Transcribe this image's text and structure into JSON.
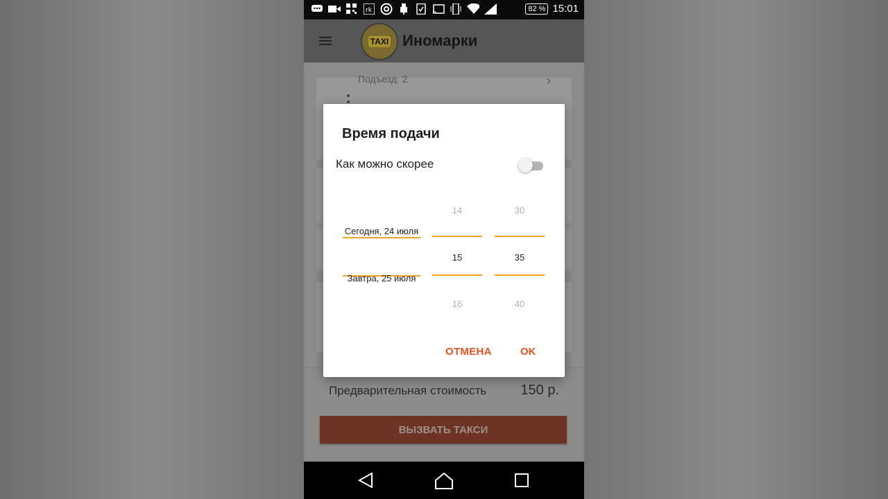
{
  "statusbar": {
    "icons": [
      "message-icon",
      "video-icon",
      "grid-icon",
      "rk-icon",
      "at-icon",
      "usb-icon",
      "checklist-icon",
      "cast-icon",
      "vibrate-icon",
      "wifi-icon",
      "signal-icon"
    ],
    "battery": "82 %",
    "time": "15:01"
  },
  "appbar": {
    "logo_text": "TAXI",
    "title": "Иномарки"
  },
  "background": {
    "entrance": "Подъезд: 2"
  },
  "dialog": {
    "title": "Время подачи",
    "asap_label": "Как можно скорее",
    "asap_enabled": false,
    "date_picker": {
      "items": [
        "Сегодня, 24 июля",
        "Завтра, 25 июля"
      ],
      "selected": "Сегодня, 24 июля"
    },
    "hour_picker": {
      "prev": "14",
      "selected": "15",
      "next": "16"
    },
    "minute_picker": {
      "prev": "30",
      "selected": "35",
      "next": "40"
    },
    "cancel_label": "ОТМЕНА",
    "ok_label": "OK"
  },
  "footer": {
    "price_label": "Предварительная стоимость",
    "price_value": "150 р.",
    "call_button": "ВЫЗВАТЬ ТАКСИ"
  },
  "colors": {
    "accent": "#e4511d",
    "picker_divider": "#f0a320"
  }
}
